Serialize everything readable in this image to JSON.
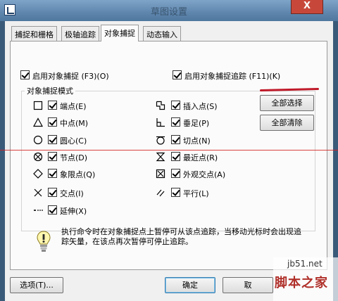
{
  "window": {
    "title": "草图设置",
    "close_symbol": "X"
  },
  "tabs": [
    {
      "label": "捕捉和栅格"
    },
    {
      "label": "极轴追踪"
    },
    {
      "label": "对象捕捉",
      "active": true
    },
    {
      "label": "动态输入"
    }
  ],
  "osnap": {
    "enable_label": "启用对象捕捉 (F3)(O)",
    "enable_checked": true,
    "tracking_label": "启用对象捕捉追踪 (F11)(K)",
    "tracking_checked": true,
    "group_title": "对象捕捉模式",
    "left_modes": [
      {
        "label": "端点(E)",
        "checked": true,
        "icon": "endpoint-square-icon"
      },
      {
        "label": "中点(M)",
        "checked": true,
        "icon": "midpoint-triangle-icon"
      },
      {
        "label": "圆心(C)",
        "checked": true,
        "icon": "center-circle-icon"
      },
      {
        "label": "节点(D)",
        "checked": true,
        "icon": "node-icon"
      },
      {
        "label": "象限点(Q)",
        "checked": true,
        "icon": "quadrant-diamond-icon"
      },
      {
        "label": "交点(I)",
        "checked": true,
        "icon": "intersection-x-icon"
      },
      {
        "label": "延伸(X)",
        "checked": true,
        "icon": "extension-dots-icon"
      }
    ],
    "right_modes": [
      {
        "label": "插入点(S)",
        "checked": true,
        "icon": "insertion-icon"
      },
      {
        "label": "垂足(P)",
        "checked": true,
        "icon": "perpendicular-icon"
      },
      {
        "label": "切点(N)",
        "checked": true,
        "icon": "tangent-icon"
      },
      {
        "label": "最近点(R)",
        "checked": true,
        "icon": "nearest-hourglass-icon"
      },
      {
        "label": "外观交点(A)",
        "checked": true,
        "icon": "apparent-intersection-icon"
      },
      {
        "label": "平行(L)",
        "checked": true,
        "icon": "parallel-icon"
      }
    ],
    "select_all_label": "全部选择",
    "clear_all_label": "全部清除",
    "hint_text": "执行命令时在对象捕捉点上暂停可从该点追踪，当移动光标时会出现追踪矢量，在该点再次暂停可停止追踪。"
  },
  "footer": {
    "options_label": "选项(T)...",
    "ok_label": "确定",
    "cancel_label": "取"
  },
  "watermark": {
    "url": "jb51.net",
    "name": "脚本之家"
  },
  "colors": {
    "titlebar": "#5f86ad",
    "close_button": "#c7483b",
    "annotation_red": "#d42020"
  }
}
